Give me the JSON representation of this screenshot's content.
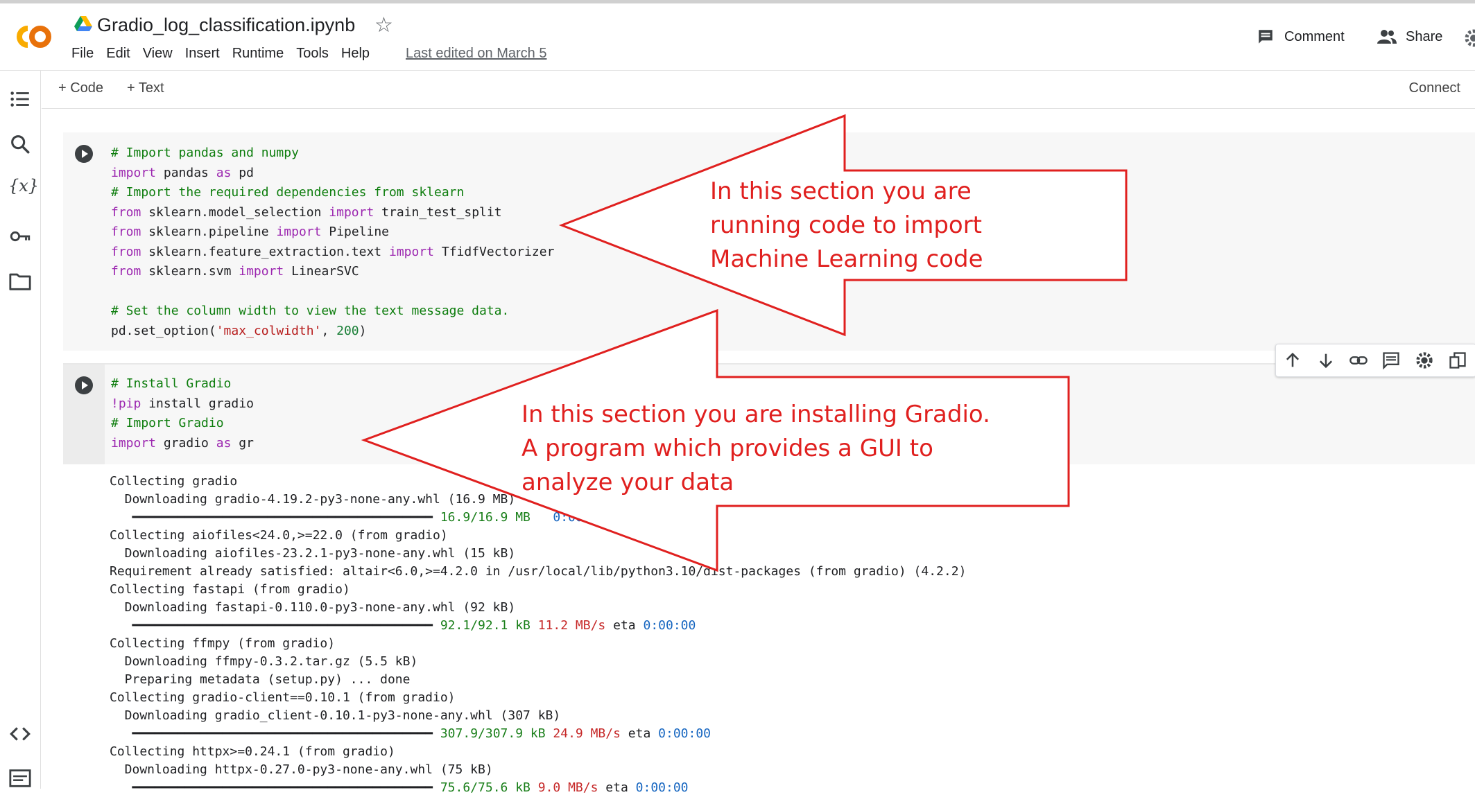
{
  "header": {
    "title": "Gradio_log_classification.ipynb",
    "menu": [
      "File",
      "Edit",
      "View",
      "Insert",
      "Runtime",
      "Tools",
      "Help"
    ],
    "last_edited": "Last edited on March 5",
    "comment_label": "Comment",
    "share_label": "Share"
  },
  "toolbar": {
    "add_code": "+ Code",
    "add_text": "+ Text",
    "connect": "Connect"
  },
  "sidebar": {
    "icons": [
      "toc-icon",
      "search-icon",
      "variables-icon",
      "key-icon",
      "folder-icon",
      "code-snippets-icon",
      "terminal-icon"
    ]
  },
  "cells": [
    {
      "code_lines": [
        "# Import pandas and numpy",
        "import pandas as pd",
        "# Import the required dependencies from sklearn",
        "from sklearn.model_selection import train_test_split",
        "from sklearn.pipeline import Pipeline",
        "from sklearn.feature_extraction.text import TfidfVectorizer",
        "from sklearn.svm import LinearSVC",
        "",
        "# Set the column width to view the text message data.",
        "pd.set_option('max_colwidth', 200)"
      ]
    },
    {
      "code_lines": [
        "# Install Gradio",
        "!pip install gradio",
        "# Import Gradio",
        "import gradio as gr"
      ]
    }
  ],
  "output": {
    "progress_bar": "━━━━━━━━━━━━━━━━━━━━━━━━━━━━━━━━━━━━━━━━",
    "lines": [
      "Collecting gradio",
      "  Downloading gradio-4.19.2-py3-none-any.whl (16.9 MB)",
      "Collecting aiofiles<24.0,>=22.0 (from gradio)",
      "  Downloading aiofiles-23.2.1-py3-none-any.whl (15 kB)",
      "Requirement already satisfied: altair<6.0,>=4.2.0 in /usr/local/lib/python3.10/dist-packages (from gradio) (4.2.2)",
      "Collecting fastapi (from gradio)",
      "  Downloading fastapi-0.110.0-py3-none-any.whl (92 kB)",
      "Collecting ffmpy (from gradio)",
      "  Downloading ffmpy-0.3.2.tar.gz (5.5 kB)",
      "  Preparing metadata (setup.py) ... done",
      "Collecting gradio-client==0.10.1 (from gradio)",
      "  Downloading gradio_client-0.10.1-py3-none-any.whl (307 kB)",
      "Collecting httpx>=0.24.1 (from gradio)",
      "  Downloading httpx-0.27.0-py3-none-any.whl (75 kB)"
    ],
    "progress_rows": [
      {
        "size": "16.9/16.9 MB",
        "speed": "",
        "eta_label": "",
        "eta": "0:00:00"
      },
      {
        "size": "92.1/92.1 kB",
        "speed": "11.2 MB/s",
        "eta_label": "eta",
        "eta": "0:00:00"
      },
      {
        "size": "307.9/307.9 kB",
        "speed": "24.9 MB/s",
        "eta_label": "eta",
        "eta": "0:00:00"
      },
      {
        "size": "75.6/75.6 kB",
        "speed": "9.0 MB/s",
        "eta_label": "eta",
        "eta": "0:00:00"
      }
    ]
  },
  "annotations": {
    "arrow1_lines": [
      "In this section you are",
      "running code to import",
      "Machine Learning code"
    ],
    "arrow2_lines": [
      "In this section you are installing Gradio.",
      "A program which provides a GUI to",
      "analyze your data"
    ],
    "color": "#e0201f"
  },
  "colors": {
    "accent_orange": "#f9ab00",
    "comment_green": "#0d7d0d",
    "keyword_purple": "#9c27b0",
    "string_red": "#b71c1c"
  }
}
